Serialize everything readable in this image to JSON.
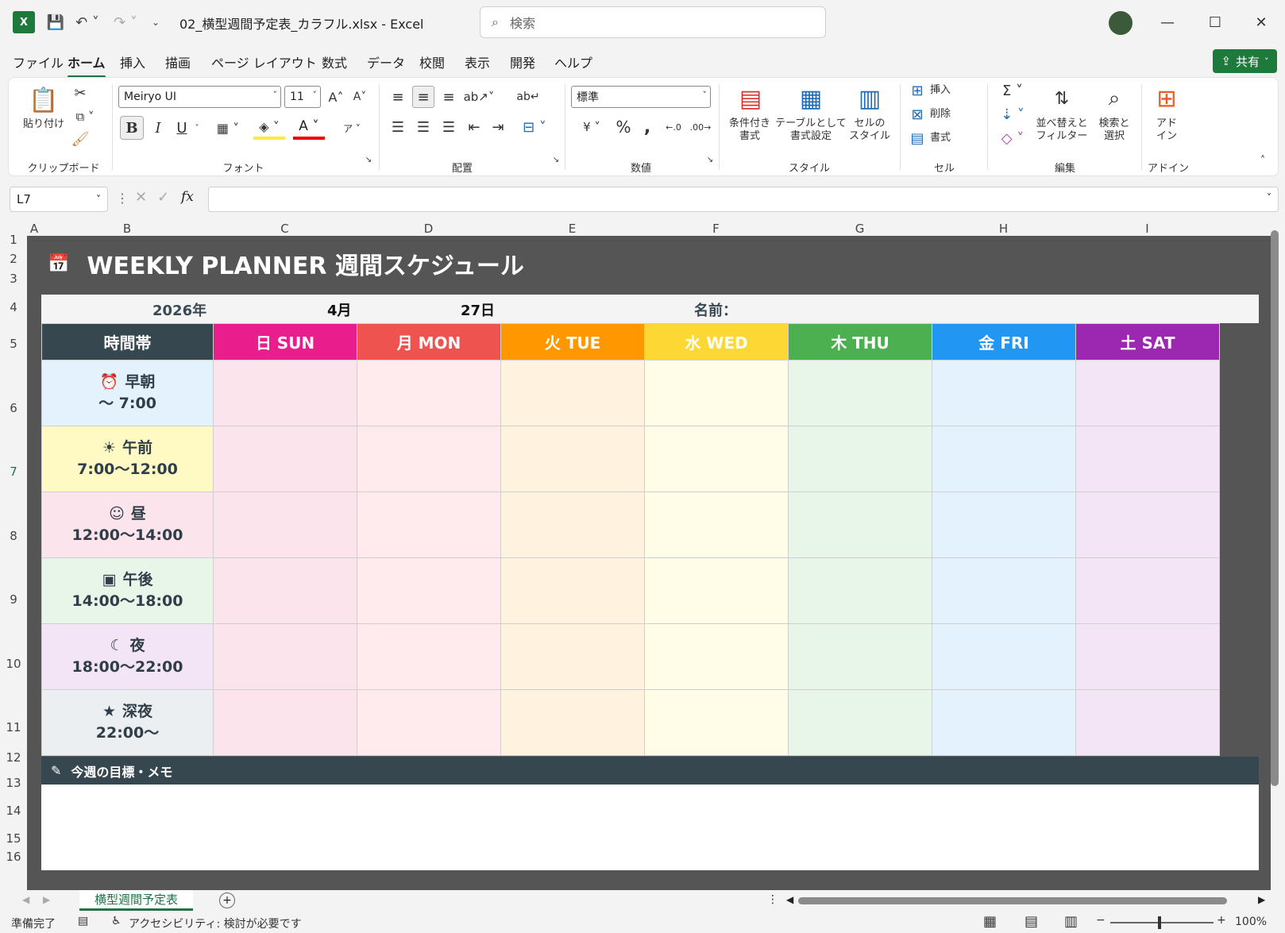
{
  "titlebar": {
    "doc_title": "02_横型週間予定表_カラフル.xlsx  -  Excel",
    "search_placeholder": "検索"
  },
  "menu": {
    "items": [
      "ファイル",
      "ホーム",
      "挿入",
      "描画",
      "ページ レイアウト",
      "数式",
      "データ",
      "校閲",
      "表示",
      "開発",
      "ヘルプ"
    ],
    "active": "ホーム",
    "share_label": "共有"
  },
  "ribbon": {
    "clipboard": {
      "paste": "貼り付け",
      "label": "クリップボード"
    },
    "font": {
      "family": "Meiryo UI",
      "size": "11",
      "label": "フォント",
      "bold": "B",
      "italic": "I",
      "underline": "U"
    },
    "alignment": {
      "label": "配置"
    },
    "number": {
      "format": "標準",
      "label": "数値"
    },
    "styles": {
      "conditional": "条件付き\n書式",
      "table": "テーブルとして\n書式設定",
      "cell": "セルの\nスタイル",
      "label": "スタイル"
    },
    "cells": {
      "insert": "挿入",
      "delete": "削除",
      "format": "書式",
      "label": "セル"
    },
    "editing": {
      "sort": "並べ替えと\nフィルター",
      "find": "検索と\n選択",
      "label": "編集"
    },
    "addins": {
      "addin": "アド\nイン",
      "label": "アドイン"
    }
  },
  "formula_bar": {
    "namebox": "L7",
    "fx": "fx",
    "value": ""
  },
  "columns": [
    "A",
    "B",
    "C",
    "D",
    "E",
    "F",
    "G",
    "H",
    "I"
  ],
  "rows": [
    "1",
    "2",
    "3",
    "4",
    "5",
    "6",
    "7",
    "8",
    "9",
    "10",
    "11",
    "12",
    "13",
    "14",
    "15",
    "16"
  ],
  "sheet": {
    "title": "WEEKLY PLANNER  週間スケジュール",
    "year": "2026年",
    "month": "4月",
    "day": "27日",
    "name_label": "名前：",
    "time_header": "時間帯",
    "days": [
      {
        "label": "日  SUN",
        "color": "#e91e8c",
        "cell": "#fce4ec"
      },
      {
        "label": "月  MON",
        "color": "#ef5350",
        "cell": "#ffebee"
      },
      {
        "label": "火  TUE",
        "color": "#ff9800",
        "cell": "#fff3e0"
      },
      {
        "label": "水  WED",
        "color": "#fdd835",
        "cell": "#fffde7"
      },
      {
        "label": "木  THU",
        "color": "#4caf50",
        "cell": "#e8f5e9"
      },
      {
        "label": "金  FRI",
        "color": "#2196f3",
        "cell": "#e3f2fd"
      },
      {
        "label": "土  SAT",
        "color": "#9c27b0",
        "cell": "#f3e5f5"
      }
    ],
    "slots": [
      {
        "name": "早朝",
        "time": "～ 7:00",
        "icon": "alarm-icon",
        "glyph": "⏰",
        "bg": "#e3f2fd"
      },
      {
        "name": "午前",
        "time": "7:00～12:00",
        "icon": "sun-icon",
        "glyph": "☀",
        "bg": "#fff9c4"
      },
      {
        "name": "昼",
        "time": "12:00～14:00",
        "icon": "smiley-icon",
        "glyph": "☺",
        "bg": "#fce4ec"
      },
      {
        "name": "午後",
        "time": "14:00～18:00",
        "icon": "picture-icon",
        "glyph": "▣",
        "bg": "#e8f5e9"
      },
      {
        "name": "夜",
        "time": "18:00～22:00",
        "icon": "moon-icon",
        "glyph": "☾",
        "bg": "#f3e5f5"
      },
      {
        "name": "深夜",
        "time": "22:00～",
        "icon": "star-icon",
        "glyph": "★",
        "bg": "#eceff1"
      }
    ],
    "memo_label": "今週の目標・メモ"
  },
  "tabs": {
    "sheet_name": "横型週間予定表"
  },
  "status": {
    "ready": "準備完了",
    "accessibility": "アクセシビリティ: 検討が必要です",
    "zoom": "100%"
  }
}
